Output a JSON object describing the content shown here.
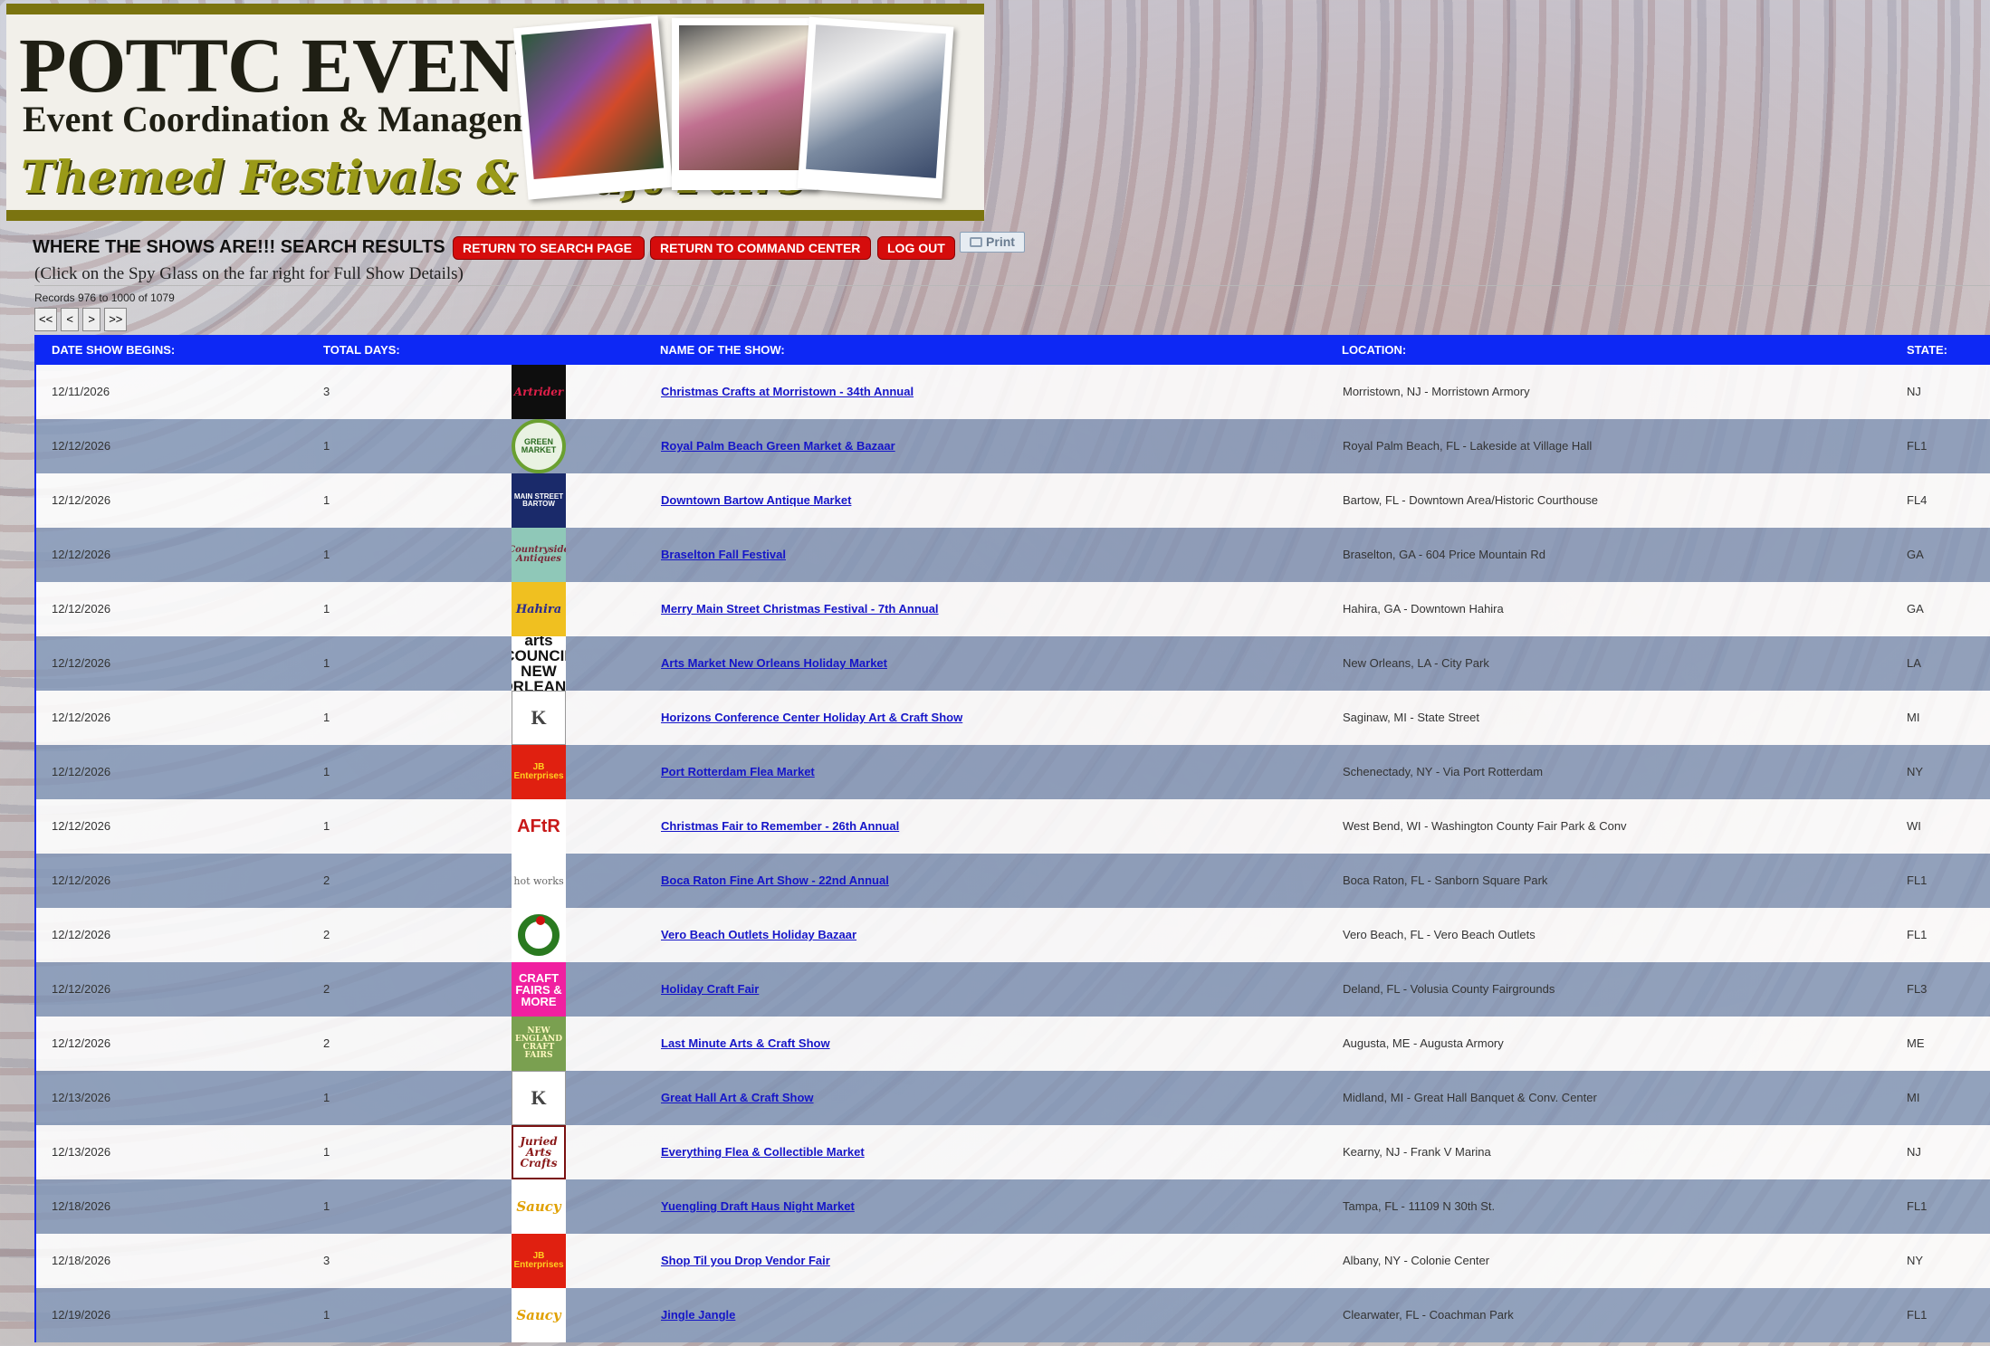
{
  "header": {
    "title_line1": "POTTC EVENTS",
    "title_line2": "Event Coordination & Management",
    "title_line3": "Themed Festivals & Craft Fairs"
  },
  "page": {
    "heading": "WHERE THE SHOWS ARE!!! SEARCH RESULTS",
    "return_search_label": "RETURN TO SEARCH PAGE",
    "return_command_label": "RETURN TO COMMAND CENTER",
    "logout_label": "LOG OUT",
    "print_label": "Print",
    "instruction": "(Click on the Spy Glass on the far right for Full Show Details)",
    "records": "Records 976 to 1000 of 1079"
  },
  "pager": {
    "first": "<<",
    "prev": "<",
    "next": ">",
    "last": ">>"
  },
  "table": {
    "headers": {
      "date": "DATE SHOW BEGINS:",
      "days": "TOTAL DAYS:",
      "name": "NAME OF THE SHOW:",
      "location": "LOCATION:",
      "state": "STATE:"
    },
    "rows": [
      {
        "date": "12/11/2026",
        "days": "3",
        "name": "Christmas Crafts at Morristown - 34th Annual",
        "location": "Morristown, NJ - Morristown Armory",
        "state": "NJ",
        "logo_text": "Artrider"
      },
      {
        "date": "12/12/2026",
        "days": "1",
        "name": "Royal Palm Beach Green Market & Bazaar",
        "location": "Royal Palm Beach, FL - Lakeside at Village Hall",
        "state": "FL1",
        "logo_text": "GREEN MARKET"
      },
      {
        "date": "12/12/2026",
        "days": "1",
        "name": "Downtown Bartow Antique Market",
        "location": "Bartow, FL - Downtown Area/Historic Courthouse",
        "state": "FL4",
        "logo_text": "MAIN STREET BARTOW"
      },
      {
        "date": "12/12/2026",
        "days": "1",
        "name": "Braselton Fall Festival",
        "location": "Braselton, GA - 604 Price Mountain Rd",
        "state": "GA",
        "logo_text": "Countryside Antiques"
      },
      {
        "date": "12/12/2026",
        "days": "1",
        "name": "Merry Main Street Christmas Festival - 7th Annual",
        "location": "Hahira, GA - Downtown Hahira",
        "state": "GA",
        "logo_text": "Hahira"
      },
      {
        "date": "12/12/2026",
        "days": "1",
        "name": "Arts Market New Orleans Holiday Market",
        "location": "New Orleans, LA - City Park",
        "state": "LA",
        "logo_text": "arts COUNCIL NEW ORLEANS"
      },
      {
        "date": "12/12/2026",
        "days": "1",
        "name": "Horizons Conference Center Holiday Art & Craft Show",
        "location": "Saginaw, MI - State Street",
        "state": "MI",
        "logo_text": "K"
      },
      {
        "date": "12/12/2026",
        "days": "1",
        "name": "Port Rotterdam Flea Market",
        "location": "Schenectady, NY - Via Port Rotterdam",
        "state": "NY",
        "logo_text": "JB Enterprises"
      },
      {
        "date": "12/12/2026",
        "days": "1",
        "name": "Christmas Fair to Remember - 26th Annual",
        "location": "West Bend, WI - Washington County Fair Park & Conv",
        "state": "WI",
        "logo_text": "AFtR"
      },
      {
        "date": "12/12/2026",
        "days": "2",
        "name": "Boca Raton Fine Art Show - 22nd Annual",
        "location": "Boca Raton, FL - Sanborn Square Park",
        "state": "FL1",
        "logo_text": "hot works"
      },
      {
        "date": "12/12/2026",
        "days": "2",
        "name": "Vero Beach Outlets Holiday Bazaar",
        "location": "Vero Beach, FL - Vero Beach Outlets",
        "state": "FL1",
        "logo_text": ""
      },
      {
        "date": "12/12/2026",
        "days": "2",
        "name": "Holiday Craft Fair",
        "location": "Deland, FL - Volusia County Fairgrounds",
        "state": "FL3",
        "logo_text": "CRAFT FAIRS & MORE"
      },
      {
        "date": "12/12/2026",
        "days": "2",
        "name": "Last Minute Arts & Craft Show",
        "location": "Augusta, ME - Augusta Armory",
        "state": "ME",
        "logo_text": "NEW ENGLAND CRAFT FAIRS"
      },
      {
        "date": "12/13/2026",
        "days": "1",
        "name": "Great Hall Art & Craft Show",
        "location": "Midland, MI - Great Hall Banquet & Conv. Center",
        "state": "MI",
        "logo_text": "K"
      },
      {
        "date": "12/13/2026",
        "days": "1",
        "name": "Everything Flea & Collectible Market",
        "location": "Kearny, NJ - Frank V Marina",
        "state": "NJ",
        "logo_text": "Juried Arts Crafts"
      },
      {
        "date": "12/18/2026",
        "days": "1",
        "name": "Yuengling Draft Haus Night Market",
        "location": "Tampa, FL - 11109 N 30th St.",
        "state": "FL1",
        "logo_text": "Saucy"
      },
      {
        "date": "12/18/2026",
        "days": "3",
        "name": "Shop Til you Drop Vendor Fair",
        "location": "Albany, NY - Colonie Center",
        "state": "NY",
        "logo_text": "JB Enterprises"
      },
      {
        "date": "12/19/2026",
        "days": "1",
        "name": "Jingle Jangle",
        "location": "Clearwater, FL - Coachman Park",
        "state": "FL1",
        "logo_text": "Saucy"
      }
    ]
  },
  "colors": {
    "header_bar": "#0d28f5",
    "button_red": "#d50c0c",
    "link": "#1515c8",
    "banner_border": "#7b7410"
  }
}
